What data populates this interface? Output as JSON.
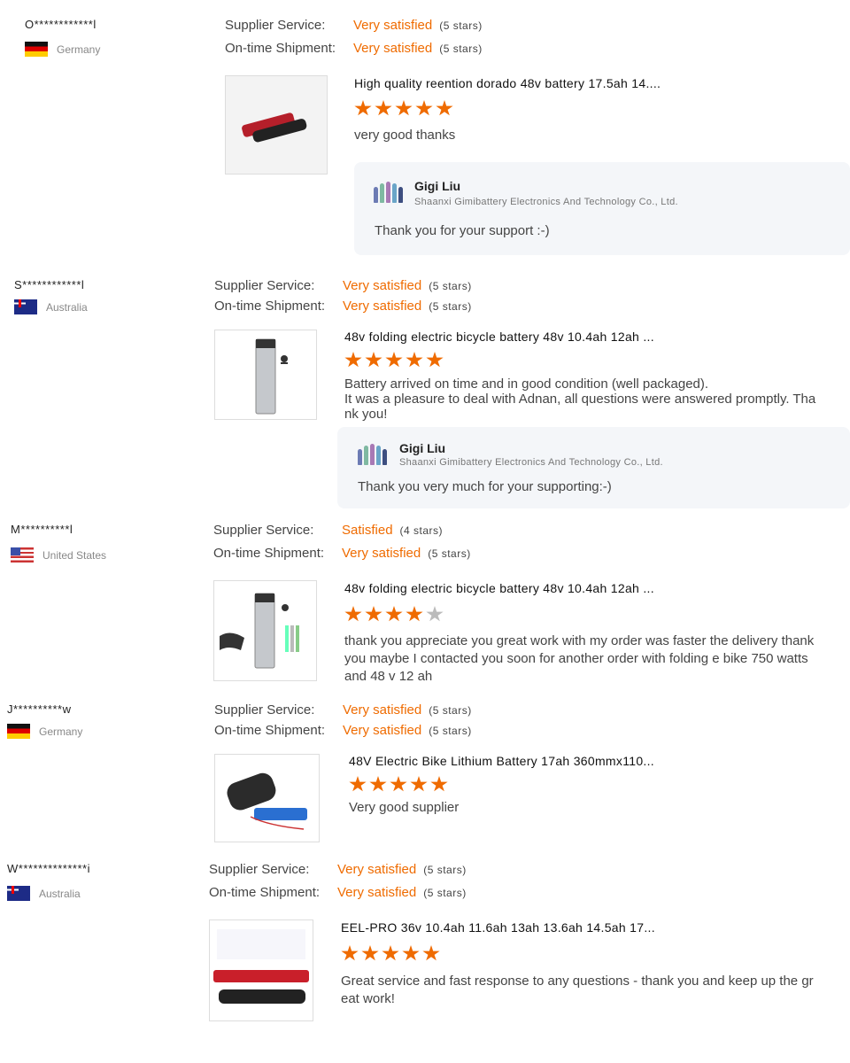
{
  "labels": {
    "supplier": "Supplier Service:",
    "shipment": "On-time Shipment:"
  },
  "accent_color": "#ef6b00",
  "reviews": [
    {
      "buyer": "O************l",
      "country": "Germany",
      "flag": "de",
      "supplier_value": "Very satisfied",
      "supplier_stars": "(5 stars)",
      "shipment_value": "Very satisfied",
      "shipment_stars": "(5 stars)",
      "product_title": "High quality reention dorado 48v battery 17.5ah 14....",
      "rating": 5,
      "comment": "very good thanks",
      "reply": {
        "name": "Gigi Liu",
        "company": "Shaanxi Gimibattery Electronics And Technology Co., Ltd.",
        "text": "Thank you for your support :-)"
      }
    },
    {
      "buyer": "S************l",
      "country": "Australia",
      "flag": "au",
      "supplier_value": "Very satisfied",
      "supplier_stars": "(5 stars)",
      "shipment_value": "Very satisfied",
      "shipment_stars": "(5 stars)",
      "product_title": "48v folding electric bicycle battery 48v 10.4ah 12ah ...",
      "rating": 5,
      "comment": "Battery arrived on time and in good condition (well packaged).\nIt was a pleasure to deal with Adnan, all questions were answered promptly. Tha\nnk you!",
      "reply": {
        "name": "Gigi Liu",
        "company": "Shaanxi Gimibattery Electronics And Technology Co., Ltd.",
        "text": "Thank you very much for your supporting:-)"
      }
    },
    {
      "buyer": "M**********l",
      "country": "United States",
      "flag": "us",
      "supplier_value": "Satisfied",
      "supplier_stars": "(4 stars)",
      "shipment_value": "Very satisfied",
      "shipment_stars": "(5 stars)",
      "product_title": "48v folding electric bicycle battery 48v 10.4ah 12ah ...",
      "rating": 4,
      "comment": "thank you appreciate you great work with my order was faster the delivery thank\nyou maybe I contacted you soon for another order with folding e bike 750 watts\nand 48 v 12 ah"
    },
    {
      "buyer": "J**********w",
      "country": "Germany",
      "flag": "de",
      "supplier_value": "Very satisfied",
      "supplier_stars": "(5 stars)",
      "shipment_value": "Very satisfied",
      "shipment_stars": "(5 stars)",
      "product_title": "48V Electric Bike Lithium Battery 17ah 360mmx110...",
      "rating": 5,
      "comment": "Very good supplier"
    },
    {
      "buyer": "W**************i",
      "country": "Australia",
      "flag": "au",
      "supplier_value": "Very satisfied",
      "supplier_stars": "(5 stars)",
      "shipment_value": "Very satisfied",
      "shipment_stars": "(5 stars)",
      "product_title": "EEL-PRO 36v 10.4ah 11.6ah 13ah 13.6ah 14.5ah 17...",
      "rating": 5,
      "comment": "Great service and fast response to any questions - thank you and keep up the gr\neat work!"
    }
  ]
}
